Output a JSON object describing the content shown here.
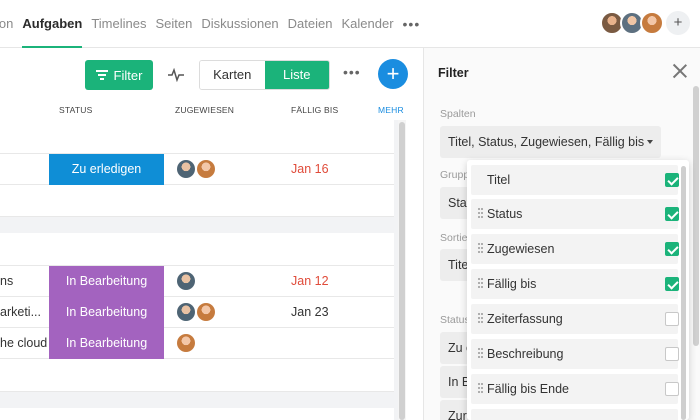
{
  "nav": {
    "tabs": [
      {
        "label": "ion",
        "active": false
      },
      {
        "label": "Aufgaben",
        "active": true
      },
      {
        "label": "Timelines",
        "active": false
      },
      {
        "label": "Seiten",
        "active": false
      },
      {
        "label": "Diskussionen",
        "active": false
      },
      {
        "label": "Dateien",
        "active": false
      },
      {
        "label": "Kalender",
        "active": false
      }
    ],
    "more": "•••",
    "add_member": "+"
  },
  "toolbar": {
    "filter_label": "Filter",
    "view_cards": "Karten",
    "view_list": "Liste",
    "more": "•••",
    "add": "+"
  },
  "table": {
    "headers": {
      "status": "STATUS",
      "assigned": "ZUGEWIESEN",
      "due": "FÄLLIG BIS",
      "more": "MEHR"
    },
    "rows": [
      {
        "name": "",
        "status": "",
        "due": ""
      },
      {
        "name": "",
        "status": "Zu erledigen",
        "due": "Jan 16"
      },
      {
        "name": "",
        "status": "",
        "due": ""
      },
      {
        "name": "",
        "status": "",
        "due": ""
      },
      {
        "name": "ns",
        "status": "In Bearbeitung",
        "due": "Jan 12"
      },
      {
        "name": "arketi...",
        "status": "In Bearbeitung",
        "due": "Jan 23"
      },
      {
        "name": "he cloud",
        "status": "In Bearbeitung",
        "due": ""
      }
    ]
  },
  "colors": {
    "accent": "#1bb37a",
    "blue": "#1a8de0",
    "status_todo": "#0f8ed6",
    "status_progress": "#a363bf",
    "overdue": "#e04b3a"
  },
  "panel": {
    "title": "Filter",
    "columns_label": "Spalten",
    "columns_value": "Titel, Status, Zugewiesen, Fällig bis",
    "group_label": "Grupp",
    "group_value": "Stat",
    "sort_label": "Sortie",
    "sort_value": "Tite",
    "status_label": "Status",
    "status_opts": [
      "Zu e",
      "In B",
      "Zur"
    ]
  },
  "dropdown": {
    "options": [
      {
        "label": "Titel",
        "checked": true
      },
      {
        "label": "Status",
        "checked": true
      },
      {
        "label": "Zugewiesen",
        "checked": true
      },
      {
        "label": "Fällig bis",
        "checked": true
      },
      {
        "label": "Zeiterfassung",
        "checked": false
      },
      {
        "label": "Beschreibung",
        "checked": false
      },
      {
        "label": "Fällig bis Ende",
        "checked": false
      }
    ]
  }
}
